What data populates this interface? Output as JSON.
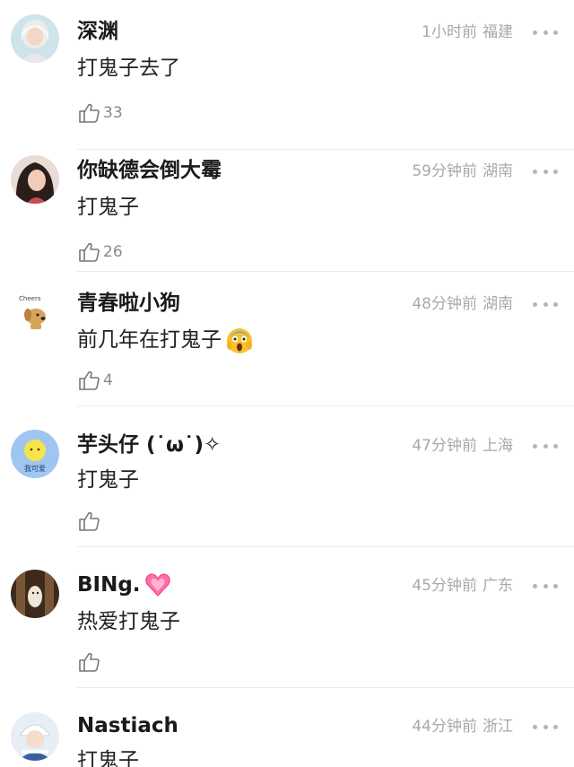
{
  "comments": [
    {
      "username": "深渊",
      "time": "1小时前",
      "location": "福建",
      "content": "打鬼子去了",
      "likes": "33",
      "avatar": "girl-white-hair-avatar"
    },
    {
      "username": "你缺德会倒大霉",
      "time": "59分钟前",
      "location": "湖南",
      "content": "打鬼子",
      "likes": "26",
      "avatar": "girl-dark-hair-avatar"
    },
    {
      "username": "青春啦小狗",
      "time": "48分钟前",
      "location": "湖南",
      "content": "前几年在打鬼子",
      "likes": "4",
      "avatar": "cheers-dog-avatar",
      "content_emoji": "screaming-face-emoji"
    },
    {
      "username": "芋头仔 (˙ω˙)✧",
      "time": "47分钟前",
      "location": "上海",
      "content": "打鬼子",
      "likes": "",
      "avatar": "yellow-face-avatar",
      "avatar_text": "我可爱"
    },
    {
      "username": "BINg.",
      "time": "45分钟前",
      "location": "广东",
      "content": "热爱打鬼子",
      "likes": "",
      "avatar": "dog-doorway-avatar",
      "name_emoji": "pink-heart-emoji"
    },
    {
      "username": "Nastiach",
      "time": "44分钟前",
      "location": "浙江",
      "content": "打鬼子",
      "likes": "",
      "avatar": "winter-girl-avatar"
    }
  ],
  "colors": {
    "meta": "#a8a8a8",
    "divider": "#ececec",
    "name": "#1a1a1a",
    "like_icon": "#777777"
  }
}
